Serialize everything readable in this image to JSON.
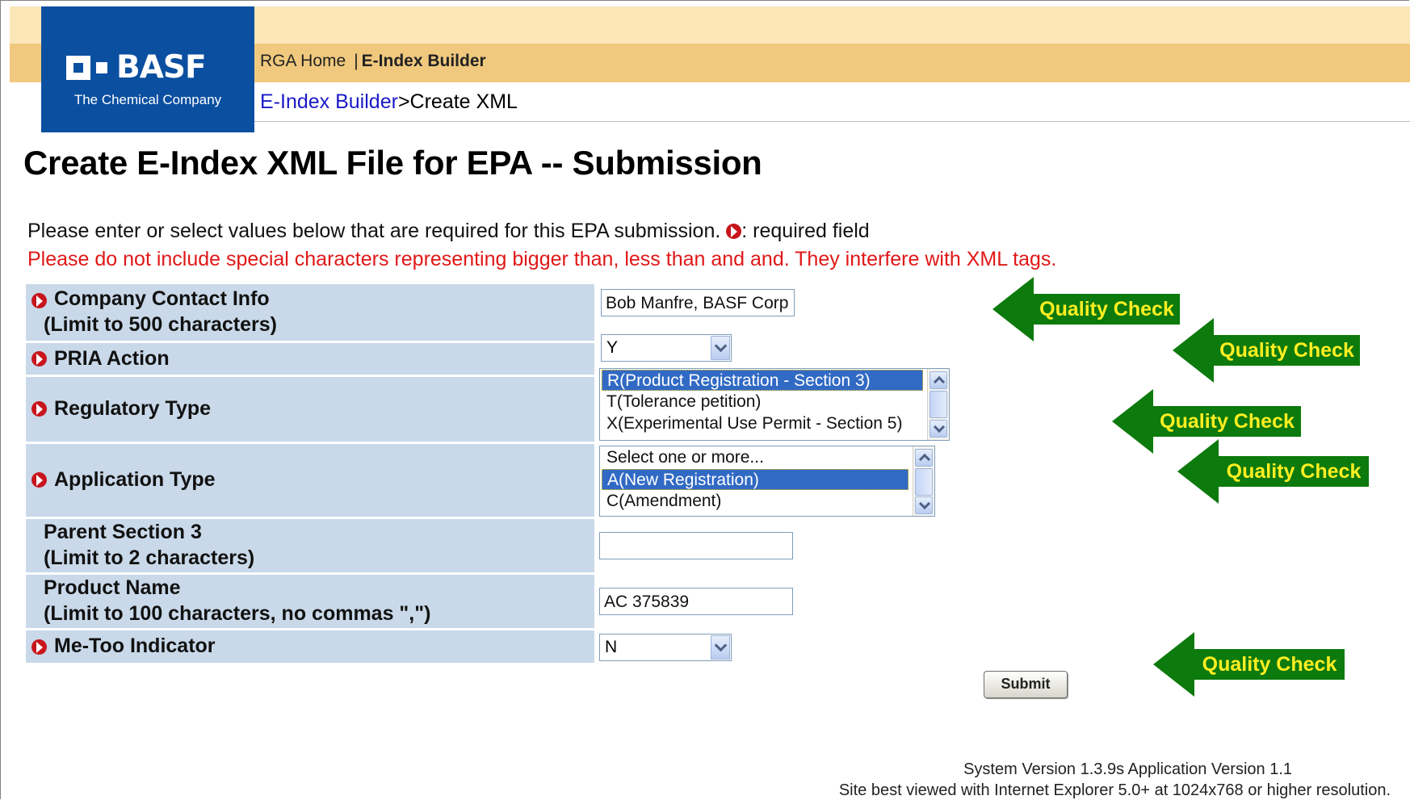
{
  "brand": {
    "name": "BASF",
    "tagline": "The Chemical Company"
  },
  "nav": {
    "home": "RGA Home",
    "separator": "|",
    "current": "E-Index Builder"
  },
  "breadcrumb": {
    "link": "E-Index Builder",
    "current": ">Create XML"
  },
  "page_title": "Create E-Index XML File for EPA -- Submission",
  "intro": {
    "text": "Please enter or select values below that are required for this EPA submission.",
    "required_note": ": required field"
  },
  "warning": "Please do not include special characters representing bigger than, less than and and. They interfere with XML tags.",
  "form": {
    "company_contact": {
      "label_line1": "Company Contact Info",
      "label_line2": "(Limit to 500 characters)",
      "value": "Bob Manfre, BASF Corp"
    },
    "pria_action": {
      "label": "PRIA Action",
      "value": "Y"
    },
    "regulatory_type": {
      "label": "Regulatory Type",
      "options": [
        "R(Product Registration - Section 3)",
        "T(Tolerance petition)",
        "X(Experimental Use Permit - Section 5)"
      ]
    },
    "application_type": {
      "label": "Application Type",
      "options": [
        "Select one or more...",
        "A(New Registration)",
        "C(Amendment)"
      ]
    },
    "parent_section": {
      "label_line1": "Parent Section 3",
      "label_line2": "(Limit to 2 characters)",
      "value": ""
    },
    "product_name": {
      "label_line1": "Product Name",
      "label_line2": "(Limit to 100 characters, no commas \",\")",
      "value": "AC 375839"
    },
    "me_too": {
      "label": "Me-Too Indicator",
      "value": "N"
    },
    "submit_label": "Submit"
  },
  "quality_check_label": "Quality Check",
  "footer": {
    "line1": "System Version 1.3.9s  Application Version 1.1",
    "line2": "Site best viewed with Internet Explorer 5.0+ at 1024x768 or higher resolution."
  },
  "colors": {
    "logo_blue": "#0b4fa0",
    "nav_band": "#f0c97e",
    "label_bg": "#c9d9e9",
    "arrow_green": "#0c7a0c",
    "arrow_text": "#ffee22",
    "warning_red": "#e01818"
  }
}
